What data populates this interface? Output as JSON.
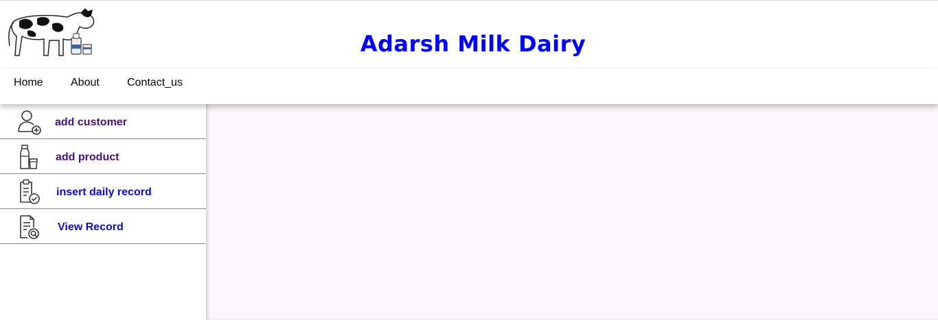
{
  "header": {
    "logo_icon": "cow-and-milk-logo",
    "title": "Adarsh Milk Dairy",
    "title_color": "#0000ff"
  },
  "nav": {
    "items": [
      {
        "label": "Home"
      },
      {
        "label": "About"
      },
      {
        "label": "Contact_us"
      }
    ]
  },
  "sidebar": {
    "items": [
      {
        "label": "add customer",
        "icon": "add-user-icon",
        "color": "#4b0f7a"
      },
      {
        "label": "add product",
        "icon": "milk-bottle-icon",
        "color": "#4b0f7a"
      },
      {
        "label": "insert daily record",
        "icon": "clipboard-check-icon",
        "color": "#0a0ad0"
      },
      {
        "label": "View Record",
        "icon": "document-search-icon",
        "color": "#0a0ad0"
      }
    ]
  },
  "colors": {
    "content_background": "#fbf6fa",
    "divider": "#8a8a8a"
  }
}
